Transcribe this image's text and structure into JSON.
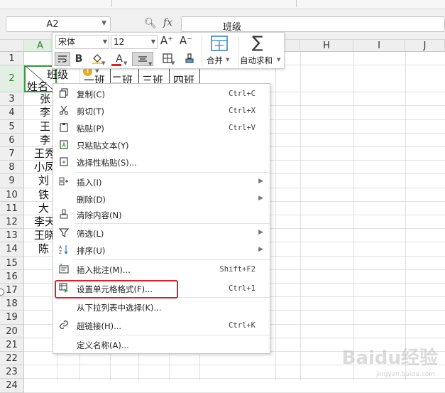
{
  "formula_bar": {
    "name_box": "A2",
    "fx": "fx",
    "zoom_icon": "magnifier-icon",
    "formula_value": "班级"
  },
  "columns": {
    "headers": [
      "A",
      "H",
      "I",
      "J"
    ]
  },
  "rows": {
    "numbers": [
      "1",
      "2",
      "3",
      "4",
      "5",
      "6",
      "7",
      "8",
      "9",
      "10",
      "11",
      "12",
      "13",
      "14",
      "15",
      "16",
      "17",
      "18",
      "19",
      "20",
      "21",
      "22",
      "23",
      "24"
    ]
  },
  "cells": {
    "a2_top": "班级",
    "a2_bottom": "姓名",
    "row2_classes": [
      "一班",
      "二班",
      "三班",
      "四班"
    ],
    "a_column": [
      "张",
      "李",
      "王",
      "李",
      "王秀",
      "小凤",
      "刘",
      "铁",
      "大",
      "李天",
      "王晓",
      "陈"
    ]
  },
  "mini_toolbar": {
    "font_name": "宋体",
    "font_size": "12",
    "grow_font": "A⁺",
    "shrink_font": "A⁻",
    "bold": "B",
    "font_color": "A",
    "merge_label": "合并",
    "autosum_label": "自动求和",
    "sum_symbol": "∑"
  },
  "context_menu": {
    "items": [
      {
        "label": "复制(C)",
        "shortcut": "Ctrl+C",
        "icon": "copy-icon"
      },
      {
        "label": "剪切(T)",
        "shortcut": "Ctrl+X",
        "icon": "scissors-icon"
      },
      {
        "label": "粘贴(P)",
        "shortcut": "Ctrl+V",
        "icon": "paste-icon"
      },
      {
        "label": "只粘贴文本(Y)",
        "shortcut": "",
        "icon": "paste-text-icon"
      },
      {
        "label": "选择性粘贴(S)...",
        "shortcut": "",
        "icon": "paste-special-icon"
      },
      {
        "label": "插入(I)",
        "shortcut": "",
        "icon": "insert-icon"
      },
      {
        "label": "删除(D)",
        "shortcut": "",
        "icon": "delete-icon"
      },
      {
        "label": "清除内容(N)",
        "shortcut": "",
        "icon": "eraser-icon"
      },
      {
        "label": "筛选(L)",
        "shortcut": "",
        "icon": "filter-icon"
      },
      {
        "label": "排序(U)",
        "shortcut": "",
        "icon": "sort-icon"
      },
      {
        "label": "插入批注(M)...",
        "shortcut": "Shift+F2",
        "icon": "comment-icon"
      },
      {
        "label": "设置单元格格式(F)...",
        "shortcut": "Ctrl+1",
        "icon": "format-cells-icon"
      },
      {
        "label": "从下拉列表中选择(K)...",
        "shortcut": "",
        "icon": ""
      },
      {
        "label": "超链接(H)...",
        "shortcut": "Ctrl+K",
        "icon": "link-icon"
      },
      {
        "label": "定义名称(A)...",
        "shortcut": "",
        "icon": ""
      }
    ]
  },
  "watermark": {
    "text": "Baidu经验",
    "sub": "jingyan.baidu.com"
  },
  "colors": {
    "selection_green": "#3c9a47",
    "highlight_red": "#e02020"
  }
}
